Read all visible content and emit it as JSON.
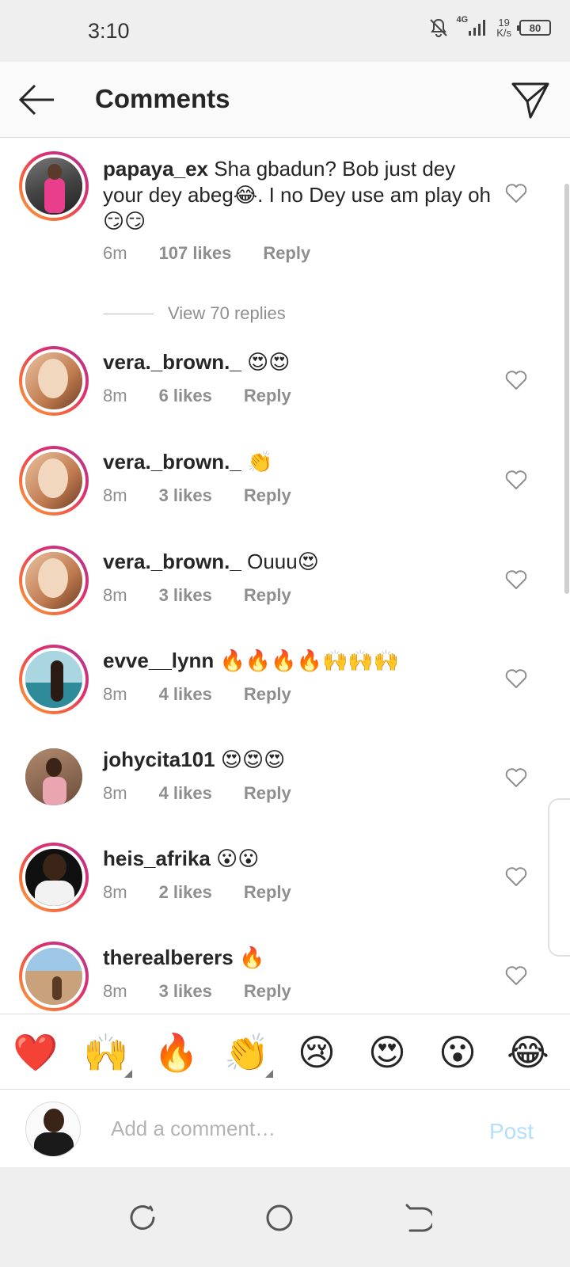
{
  "status_bar": {
    "time": "3:10",
    "network": "4G",
    "speed_value": "19",
    "speed_unit": "K/s",
    "battery": "80"
  },
  "header": {
    "title": "Comments"
  },
  "comments": [
    {
      "username": "papaya_ex",
      "text": "Sha gbadun? Bob just dey your dey abeg😂. I no Dey use am play oh😏😏",
      "time": "6m",
      "likes": "107 likes",
      "reply": "Reply",
      "view_replies": "View 70 replies"
    },
    {
      "username": "vera._brown._",
      "text": "😍😍",
      "time": "8m",
      "likes": "6 likes",
      "reply": "Reply"
    },
    {
      "username": "vera._brown._",
      "text": "👏",
      "time": "8m",
      "likes": "3 likes",
      "reply": "Reply"
    },
    {
      "username": "vera._brown._",
      "text": "Ouuu😍",
      "time": "8m",
      "likes": "3 likes",
      "reply": "Reply"
    },
    {
      "username": "evve__lynn",
      "text": "🔥🔥🔥🔥🙌🙌🙌",
      "time": "8m",
      "likes": "4 likes",
      "reply": "Reply"
    },
    {
      "username": "johycita101",
      "text": "😍😍😍",
      "time": "8m",
      "likes": "4 likes",
      "reply": "Reply"
    },
    {
      "username": "heis_afrika",
      "text": "😮😮",
      "time": "8m",
      "likes": "2 likes",
      "reply": "Reply"
    },
    {
      "username": "therealberers",
      "text": "🔥",
      "time": "8m",
      "likes": "3 likes",
      "reply": "Reply"
    }
  ],
  "emoji_bar": [
    "❤️",
    "🙌",
    "🔥",
    "👏",
    "😢",
    "😍",
    "😮",
    "😂"
  ],
  "composer": {
    "placeholder": "Add a comment…",
    "post_label": "Post"
  },
  "colors": {
    "accent_link": "#b2dffc",
    "muted_text": "#8e8e8e",
    "story_ring_start": "#f9a43a",
    "story_ring_end": "#833ab4"
  }
}
